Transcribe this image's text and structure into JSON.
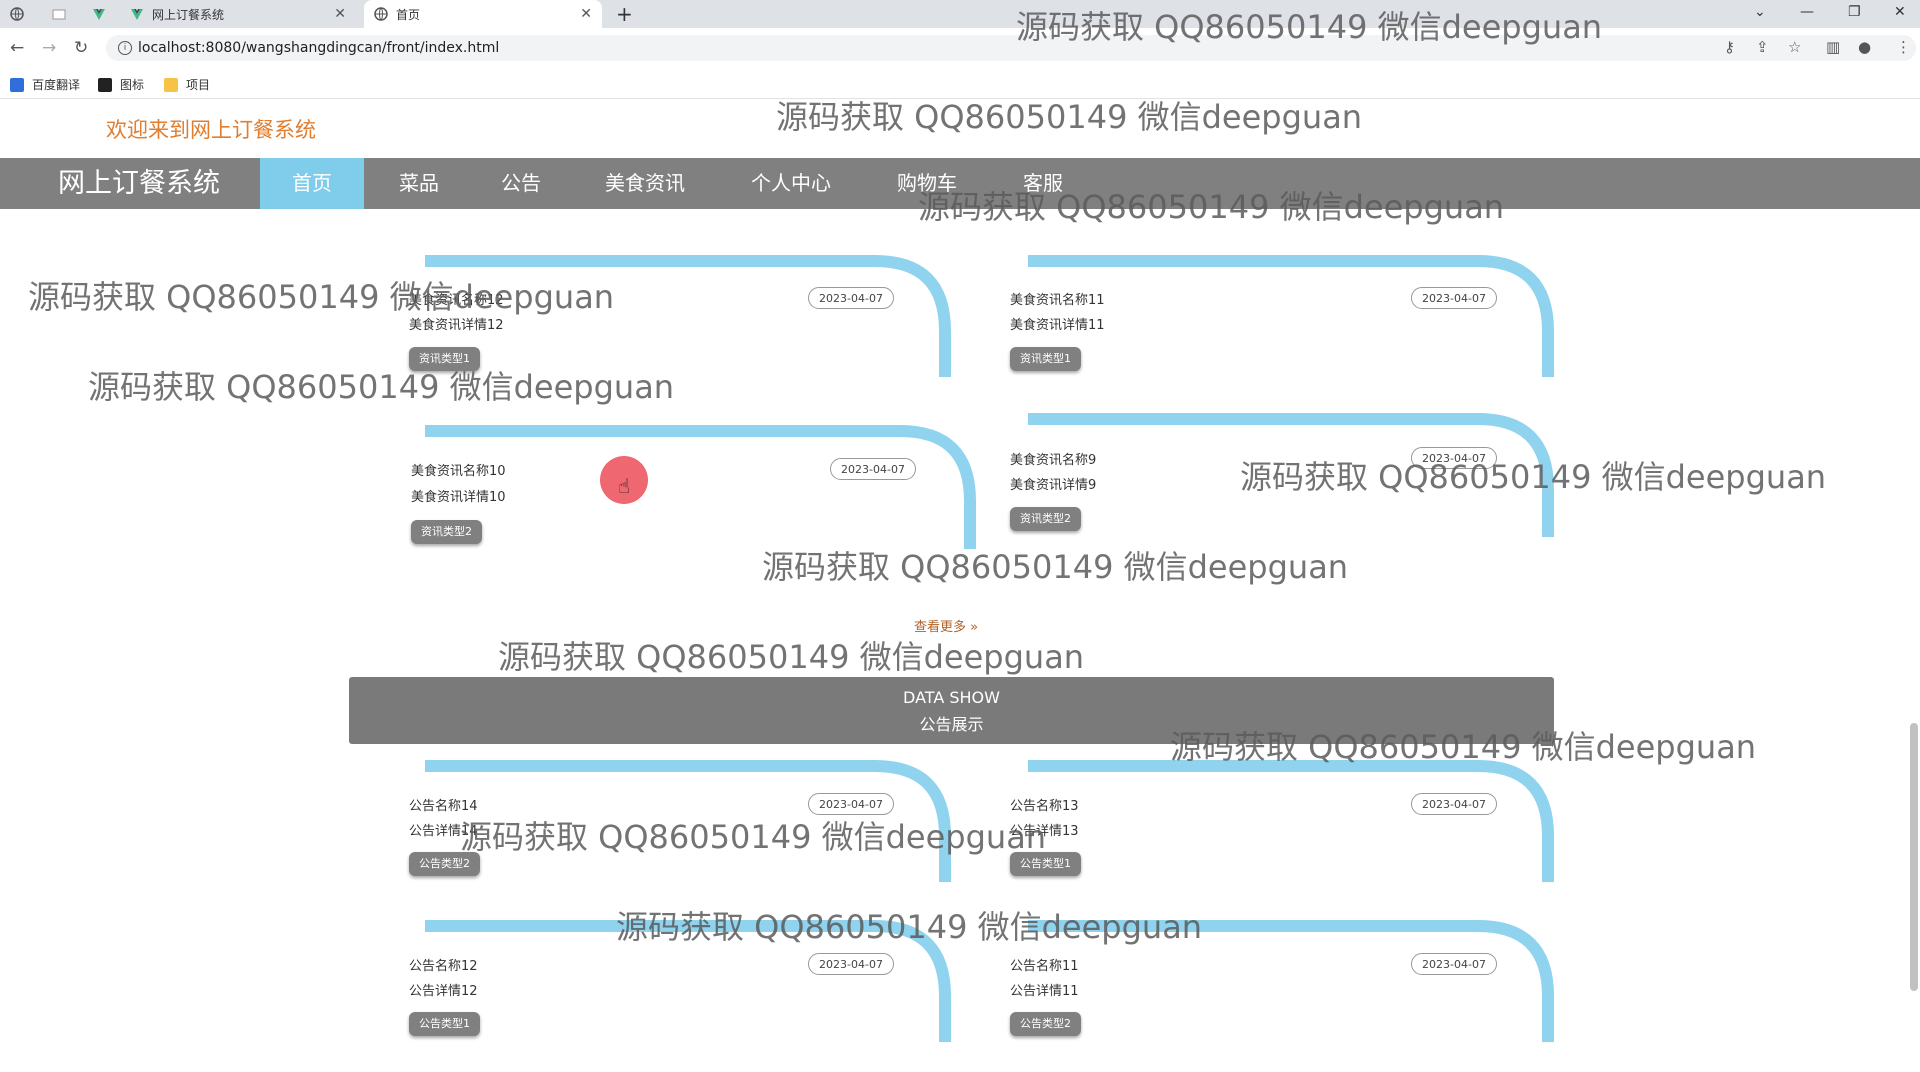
{
  "browser": {
    "tabs": [
      {
        "title": ""
      },
      {
        "title": ""
      },
      {
        "title": ""
      },
      {
        "title": "网上订餐系统"
      },
      {
        "title": "首页"
      }
    ],
    "new_tab": "+",
    "url": "localhost:8080/wangshangdingcan/front/index.html",
    "bookmarks": [
      {
        "label": "百度翻译"
      },
      {
        "label": "图标"
      },
      {
        "label": "项目"
      }
    ]
  },
  "header": {
    "welcome": "欢迎来到网上订餐系统"
  },
  "nav": {
    "brand": "网上订餐系统",
    "items": [
      {
        "label": "首页",
        "active": true
      },
      {
        "label": "菜品"
      },
      {
        "label": "公告"
      },
      {
        "label": "美食资讯"
      },
      {
        "label": "个人中心"
      },
      {
        "label": "购物车"
      },
      {
        "label": "客服"
      }
    ]
  },
  "news": [
    {
      "title": "美食资讯名称12",
      "detail": "美食资讯详情12",
      "date": "2023-04-07",
      "type": "资讯类型1"
    },
    {
      "title": "美食资讯名称11",
      "detail": "美食资讯详情11",
      "date": "2023-04-07",
      "type": "资讯类型1"
    },
    {
      "title": "美食资讯名称10",
      "detail": "美食资讯详情10",
      "date": "2023-04-07",
      "type": "资讯类型2"
    },
    {
      "title": "美食资讯名称9",
      "detail": "美食资讯详情9",
      "date": "2023-04-07",
      "type": "资讯类型2"
    }
  ],
  "see_more": "查看更多 »",
  "section_banner": {
    "en": "DATA SHOW",
    "zh": "公告展示"
  },
  "notices": [
    {
      "title": "公告名称14",
      "detail": "公告详情14",
      "date": "2023-04-07",
      "type": "公告类型2"
    },
    {
      "title": "公告名称13",
      "detail": "公告详情13",
      "date": "2023-04-07",
      "type": "公告类型1"
    },
    {
      "title": "公告名称12",
      "detail": "公告详情12",
      "date": "2023-04-07",
      "type": "公告类型1"
    },
    {
      "title": "公告名称11",
      "detail": "公告详情11",
      "date": "2023-04-07",
      "type": "公告类型2"
    }
  ],
  "watermark": "源码获取 QQ86050149 微信deepguan",
  "colors": {
    "accent": "#7fcdea",
    "nav_bg": "#808080",
    "welcome": "#e07d2f"
  }
}
